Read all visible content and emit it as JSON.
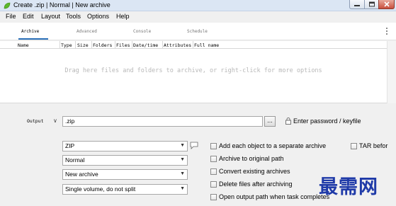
{
  "titlebar": {
    "title": "Create .zip | Normal | New archive"
  },
  "menu": {
    "items": [
      "File",
      "Edit",
      "Layout",
      "Tools",
      "Options",
      "Help"
    ]
  },
  "tabs": [
    "Archive",
    "Advanced",
    "Console",
    "Schedule"
  ],
  "filelist": {
    "columns": [
      "Name",
      "Type",
      "Size",
      "Folders",
      "Files",
      "Date/time",
      "Attributes",
      "Full name"
    ],
    "empty_hint": "Drag here files and folders to archive, or right-click for more options"
  },
  "output": {
    "label": "Output",
    "value": ".zip",
    "browse_label": "...",
    "password_label": "Enter password / keyfile"
  },
  "combos": {
    "format": "ZIP",
    "level": "Normal",
    "mode": "New archive",
    "split": "Single volume, do not split"
  },
  "checkboxes": {
    "separate": "Add each object to a separate archive",
    "original_path": "Archive to original path",
    "convert": "Convert existing archives",
    "delete": "Delete files after archiving",
    "open_output": "Open output path when task completes",
    "tar_before": "TAR befor"
  },
  "watermark": "最需网",
  "colors": {
    "accent": "#2a6fb8",
    "watermark": "#1f3aa8"
  }
}
